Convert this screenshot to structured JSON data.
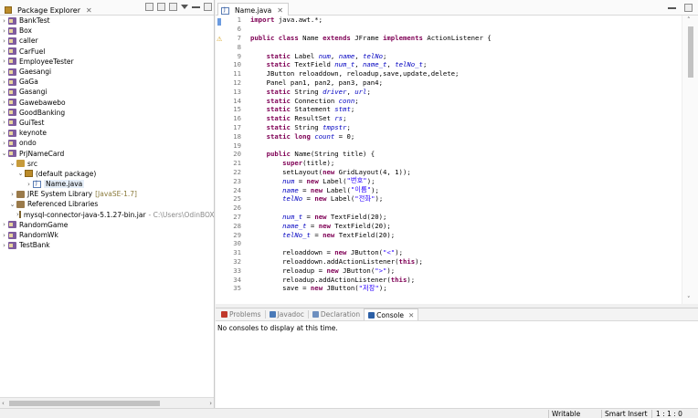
{
  "package_explorer": {
    "title": "Package Explorer",
    "close": "✕",
    "items": [
      {
        "label": "BankTest"
      },
      {
        "label": "Box"
      },
      {
        "label": "caller"
      },
      {
        "label": "CarFuel"
      },
      {
        "label": "EmployeeTester"
      },
      {
        "label": "Gaesangi"
      },
      {
        "label": "GaGa"
      },
      {
        "label": "Gasangi"
      },
      {
        "label": "Gawebawebo"
      },
      {
        "label": "GoodBanking"
      },
      {
        "label": "GuiTest"
      },
      {
        "label": "keynote"
      },
      {
        "label": "ondo"
      },
      {
        "label": "PrjNameCard"
      },
      {
        "label": "src"
      },
      {
        "label": "(default package)"
      },
      {
        "label": "Name.java"
      },
      {
        "label": "JRE System Library",
        "extra": "[JavaSE-1.7]"
      },
      {
        "label": "Referenced Libraries"
      },
      {
        "label": "mysql-connector-java-5.1.27-bin.jar",
        "extra": "- C:\\Users\\OdinBOX"
      },
      {
        "label": "RandomGame"
      },
      {
        "label": "RandomWk"
      },
      {
        "label": "TestBank"
      }
    ]
  },
  "editor": {
    "tab_label": "Name.java",
    "close": "✕",
    "lines": [
      {
        "n": "1",
        "t": [
          {
            "c": "kw",
            "s": "import"
          },
          {
            "c": "plain",
            "s": " java.awt.*;"
          }
        ]
      },
      {
        "n": "6",
        "t": []
      },
      {
        "n": "7",
        "t": [
          {
            "c": "kw",
            "s": "public class"
          },
          {
            "c": "plain",
            "s": " Name "
          },
          {
            "c": "kw",
            "s": "extends"
          },
          {
            "c": "plain",
            "s": " JFrame "
          },
          {
            "c": "kw",
            "s": "implements"
          },
          {
            "c": "plain",
            "s": " ActionListener {"
          }
        ]
      },
      {
        "n": "8",
        "t": []
      },
      {
        "n": "9",
        "t": [
          {
            "c": "plain",
            "s": "    "
          },
          {
            "c": "kw",
            "s": "static"
          },
          {
            "c": "plain",
            "s": " Label "
          },
          {
            "c": "fld",
            "s": "num"
          },
          {
            "c": "plain",
            "s": ", "
          },
          {
            "c": "fld",
            "s": "name"
          },
          {
            "c": "plain",
            "s": ", "
          },
          {
            "c": "fld",
            "s": "telNo"
          },
          {
            "c": "plain",
            "s": ";"
          }
        ]
      },
      {
        "n": "10",
        "t": [
          {
            "c": "plain",
            "s": "    "
          },
          {
            "c": "kw",
            "s": "static"
          },
          {
            "c": "plain",
            "s": " TextField "
          },
          {
            "c": "fld",
            "s": "num_t"
          },
          {
            "c": "plain",
            "s": ", "
          },
          {
            "c": "fld",
            "s": "name_t"
          },
          {
            "c": "plain",
            "s": ", "
          },
          {
            "c": "fld",
            "s": "telNo_t"
          },
          {
            "c": "plain",
            "s": ";"
          }
        ]
      },
      {
        "n": "11",
        "t": [
          {
            "c": "plain",
            "s": "    JButton reloaddown, reloadup,save,update,delete;"
          }
        ]
      },
      {
        "n": "12",
        "t": [
          {
            "c": "plain",
            "s": "    Panel pan1, pan2, pan3, pan4;"
          }
        ]
      },
      {
        "n": "13",
        "t": [
          {
            "c": "plain",
            "s": "    "
          },
          {
            "c": "kw",
            "s": "static"
          },
          {
            "c": "plain",
            "s": " String "
          },
          {
            "c": "fld",
            "s": "driver"
          },
          {
            "c": "plain",
            "s": ", "
          },
          {
            "c": "fld",
            "s": "url"
          },
          {
            "c": "plain",
            "s": ";"
          }
        ]
      },
      {
        "n": "14",
        "t": [
          {
            "c": "plain",
            "s": "    "
          },
          {
            "c": "kw",
            "s": "static"
          },
          {
            "c": "plain",
            "s": " Connection "
          },
          {
            "c": "fld",
            "s": "conn"
          },
          {
            "c": "plain",
            "s": ";"
          }
        ]
      },
      {
        "n": "15",
        "t": [
          {
            "c": "plain",
            "s": "    "
          },
          {
            "c": "kw",
            "s": "static"
          },
          {
            "c": "plain",
            "s": " Statement "
          },
          {
            "c": "fld",
            "s": "stmt"
          },
          {
            "c": "plain",
            "s": ";"
          }
        ]
      },
      {
        "n": "16",
        "t": [
          {
            "c": "plain",
            "s": "    "
          },
          {
            "c": "kw",
            "s": "static"
          },
          {
            "c": "plain",
            "s": " ResultSet "
          },
          {
            "c": "fld",
            "s": "rs"
          },
          {
            "c": "plain",
            "s": ";"
          }
        ]
      },
      {
        "n": "17",
        "t": [
          {
            "c": "plain",
            "s": "    "
          },
          {
            "c": "kw",
            "s": "static"
          },
          {
            "c": "plain",
            "s": " String "
          },
          {
            "c": "fld",
            "s": "tmpstr"
          },
          {
            "c": "plain",
            "s": ";"
          }
        ]
      },
      {
        "n": "18",
        "t": [
          {
            "c": "plain",
            "s": "    "
          },
          {
            "c": "kw",
            "s": "static long"
          },
          {
            "c": "plain",
            "s": " "
          },
          {
            "c": "fld",
            "s": "count"
          },
          {
            "c": "plain",
            "s": " = 0;"
          }
        ]
      },
      {
        "n": "19",
        "t": []
      },
      {
        "n": "20",
        "t": [
          {
            "c": "plain",
            "s": "    "
          },
          {
            "c": "kw",
            "s": "public"
          },
          {
            "c": "plain",
            "s": " Name(String title) {"
          }
        ]
      },
      {
        "n": "21",
        "t": [
          {
            "c": "plain",
            "s": "        "
          },
          {
            "c": "kw",
            "s": "super"
          },
          {
            "c": "plain",
            "s": "(title);"
          }
        ]
      },
      {
        "n": "22",
        "t": [
          {
            "c": "plain",
            "s": "        setLayout("
          },
          {
            "c": "kw",
            "s": "new"
          },
          {
            "c": "plain",
            "s": " GridLayout(4, 1));"
          }
        ]
      },
      {
        "n": "23",
        "t": [
          {
            "c": "plain",
            "s": "        "
          },
          {
            "c": "fld",
            "s": "num"
          },
          {
            "c": "plain",
            "s": " = "
          },
          {
            "c": "kw",
            "s": "new"
          },
          {
            "c": "plain",
            "s": " Label("
          },
          {
            "c": "str",
            "s": "\"번호\""
          },
          {
            "c": "plain",
            "s": ");"
          }
        ]
      },
      {
        "n": "24",
        "t": [
          {
            "c": "plain",
            "s": "        "
          },
          {
            "c": "fld",
            "s": "name"
          },
          {
            "c": "plain",
            "s": " = "
          },
          {
            "c": "kw",
            "s": "new"
          },
          {
            "c": "plain",
            "s": " Label("
          },
          {
            "c": "str",
            "s": "\"이름\""
          },
          {
            "c": "plain",
            "s": ");"
          }
        ]
      },
      {
        "n": "25",
        "t": [
          {
            "c": "plain",
            "s": "        "
          },
          {
            "c": "fld",
            "s": "telNo"
          },
          {
            "c": "plain",
            "s": " = "
          },
          {
            "c": "kw",
            "s": "new"
          },
          {
            "c": "plain",
            "s": " Label("
          },
          {
            "c": "str",
            "s": "\"전화\""
          },
          {
            "c": "plain",
            "s": ");"
          }
        ]
      },
      {
        "n": "26",
        "t": []
      },
      {
        "n": "27",
        "t": [
          {
            "c": "plain",
            "s": "        "
          },
          {
            "c": "fld",
            "s": "num_t"
          },
          {
            "c": "plain",
            "s": " = "
          },
          {
            "c": "kw",
            "s": "new"
          },
          {
            "c": "plain",
            "s": " TextField(20);"
          }
        ]
      },
      {
        "n": "28",
        "t": [
          {
            "c": "plain",
            "s": "        "
          },
          {
            "c": "fld",
            "s": "name_t"
          },
          {
            "c": "plain",
            "s": " = "
          },
          {
            "c": "kw",
            "s": "new"
          },
          {
            "c": "plain",
            "s": " TextField(20);"
          }
        ]
      },
      {
        "n": "29",
        "t": [
          {
            "c": "plain",
            "s": "        "
          },
          {
            "c": "fld",
            "s": "telNo_t"
          },
          {
            "c": "plain",
            "s": " = "
          },
          {
            "c": "kw",
            "s": "new"
          },
          {
            "c": "plain",
            "s": " TextField(20);"
          }
        ]
      },
      {
        "n": "30",
        "t": []
      },
      {
        "n": "31",
        "t": [
          {
            "c": "plain",
            "s": "        reloaddown = "
          },
          {
            "c": "kw",
            "s": "new"
          },
          {
            "c": "plain",
            "s": " JButton("
          },
          {
            "c": "str",
            "s": "\"<\""
          },
          {
            "c": "plain",
            "s": ");"
          }
        ]
      },
      {
        "n": "32",
        "t": [
          {
            "c": "plain",
            "s": "        reloaddown.addActionListener("
          },
          {
            "c": "kw",
            "s": "this"
          },
          {
            "c": "plain",
            "s": ");"
          }
        ]
      },
      {
        "n": "33",
        "t": [
          {
            "c": "plain",
            "s": "        reloadup = "
          },
          {
            "c": "kw",
            "s": "new"
          },
          {
            "c": "plain",
            "s": " JButton("
          },
          {
            "c": "str",
            "s": "\">\""
          },
          {
            "c": "plain",
            "s": ");"
          }
        ]
      },
      {
        "n": "34",
        "t": [
          {
            "c": "plain",
            "s": "        reloadup.addActionListener("
          },
          {
            "c": "kw",
            "s": "this"
          },
          {
            "c": "plain",
            "s": ");"
          }
        ]
      },
      {
        "n": "35",
        "t": [
          {
            "c": "plain",
            "s": "        save = "
          },
          {
            "c": "kw",
            "s": "new"
          },
          {
            "c": "plain",
            "s": " JButton("
          },
          {
            "c": "str",
            "s": "\"저장\""
          },
          {
            "c": "plain",
            "s": ");"
          }
        ]
      }
    ]
  },
  "console_panel": {
    "tabs": [
      {
        "label": "Problems",
        "color": "#c0392b"
      },
      {
        "label": "Javadoc",
        "color": "#4a7ab8"
      },
      {
        "label": "Declaration",
        "color": "#6d8fbf"
      },
      {
        "label": "Console",
        "color": "#2b5fa6"
      }
    ],
    "close": "✕",
    "message": "No consoles to display at this time."
  },
  "status_bar": {
    "writable": "Writable",
    "insert_mode": "Smart Insert",
    "position": "1 : 1 : 0"
  }
}
